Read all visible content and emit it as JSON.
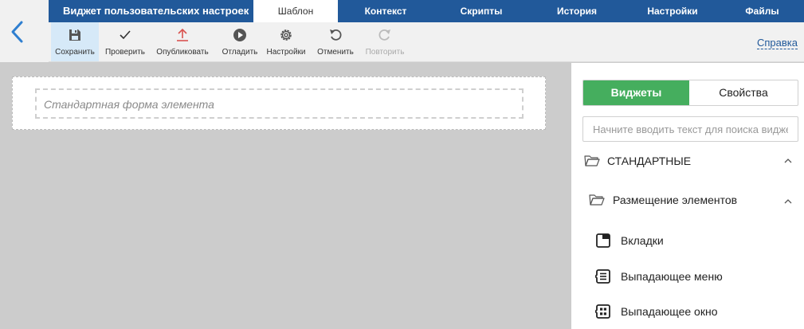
{
  "header": {
    "title": "Виджет пользовательских настроек",
    "tabs": [
      {
        "label": "Шаблон",
        "active": true
      },
      {
        "label": "Контекст"
      },
      {
        "label": "Скрипты"
      },
      {
        "label": "История"
      },
      {
        "label": "Настройки"
      },
      {
        "label": "Файлы"
      }
    ]
  },
  "toolbar": {
    "save": "Сохранить",
    "check": "Проверить",
    "publish": "Опубликовать",
    "debug": "Отладить",
    "settings": "Настройки",
    "undo": "Отменить",
    "redo": "Повторить",
    "help": "Справка"
  },
  "canvas": {
    "form_placeholder": "Стандартная форма элемента"
  },
  "panel": {
    "tab_widgets": "Виджеты",
    "tab_properties": "Свойства",
    "search_placeholder": "Начните вводить текст для поиска виджета",
    "group_standard": "СТАНДАРТНЫЕ",
    "subgroup_layout": "Размещение элементов",
    "widgets": [
      {
        "label": "Вкладки",
        "icon": "tabs-icon"
      },
      {
        "label": "Выпадающее меню",
        "icon": "dropdown-menu-icon"
      },
      {
        "label": "Выпадающее окно",
        "icon": "popup-window-icon"
      }
    ]
  },
  "colors": {
    "header": "#21599a",
    "active_tool": "#d6e9f8",
    "widgets_tab": "#45ae5e",
    "publish_icon": "#d9534f",
    "back_arrow": "#2f7fd0"
  }
}
